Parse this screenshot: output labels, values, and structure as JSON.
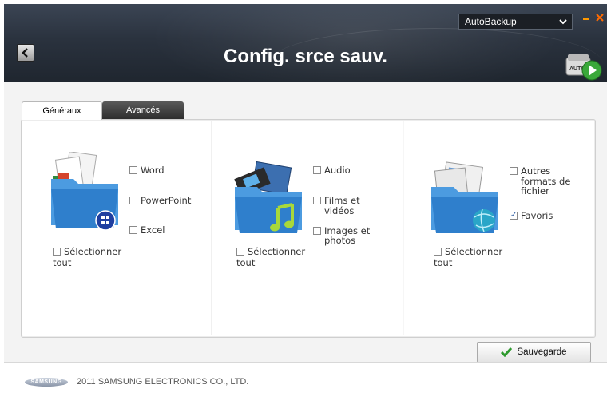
{
  "header": {
    "title": "Config. srce sauv.",
    "profile_select": "AutoBackup",
    "auto_badge": "AUTO"
  },
  "tabs": [
    {
      "label": "Généraux",
      "active": true
    },
    {
      "label": "Avancés",
      "active": false
    }
  ],
  "columns": [
    {
      "items": [
        {
          "label": "Word",
          "checked": false
        },
        {
          "label": "PowerPoint",
          "checked": false
        },
        {
          "label": "Excel",
          "checked": false
        }
      ],
      "select_all": {
        "line1": "Sélectionner",
        "line2": "tout",
        "checked": false
      }
    },
    {
      "items": [
        {
          "label": "Audio",
          "checked": false
        },
        {
          "label": "Films et",
          "label2": "vidéos",
          "checked": false
        },
        {
          "label": "Images et",
          "label2": "photos",
          "checked": false
        }
      ],
      "select_all": {
        "line1": "Sélectionner",
        "line2": "tout",
        "checked": false
      }
    },
    {
      "items": [
        {
          "label": "Autres",
          "label2": "formats de",
          "label3": "fichier",
          "checked": false
        },
        {
          "label": "Favoris",
          "checked": true
        }
      ],
      "select_all": {
        "line1": "Sélectionner",
        "line2": "tout",
        "checked": false
      }
    }
  ],
  "save_button": {
    "label": "Sauvegarde"
  },
  "footer": {
    "logo": "SAMSUNG",
    "copyright": "2011 SAMSUNG ELECTRONICS CO., LTD."
  },
  "colors": {
    "header_bg": "#2a323e",
    "accent_orange": "#ff7a00",
    "check_green": "#2e9a2e",
    "folder_blue": "#3b8fd4"
  }
}
